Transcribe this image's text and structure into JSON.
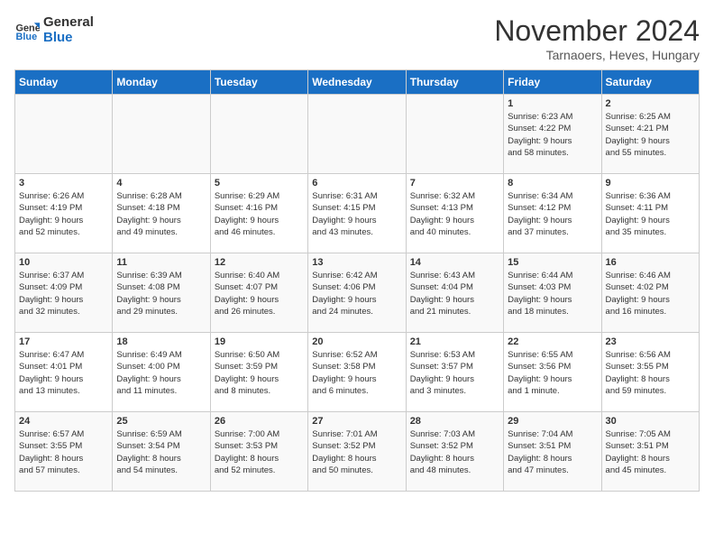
{
  "header": {
    "logo_line1": "General",
    "logo_line2": "Blue",
    "month": "November 2024",
    "location": "Tarnaoers, Heves, Hungary"
  },
  "days_of_week": [
    "Sunday",
    "Monday",
    "Tuesday",
    "Wednesday",
    "Thursday",
    "Friday",
    "Saturday"
  ],
  "weeks": [
    [
      {
        "day": "",
        "info": ""
      },
      {
        "day": "",
        "info": ""
      },
      {
        "day": "",
        "info": ""
      },
      {
        "day": "",
        "info": ""
      },
      {
        "day": "",
        "info": ""
      },
      {
        "day": "1",
        "info": "Sunrise: 6:23 AM\nSunset: 4:22 PM\nDaylight: 9 hours\nand 58 minutes."
      },
      {
        "day": "2",
        "info": "Sunrise: 6:25 AM\nSunset: 4:21 PM\nDaylight: 9 hours\nand 55 minutes."
      }
    ],
    [
      {
        "day": "3",
        "info": "Sunrise: 6:26 AM\nSunset: 4:19 PM\nDaylight: 9 hours\nand 52 minutes."
      },
      {
        "day": "4",
        "info": "Sunrise: 6:28 AM\nSunset: 4:18 PM\nDaylight: 9 hours\nand 49 minutes."
      },
      {
        "day": "5",
        "info": "Sunrise: 6:29 AM\nSunset: 4:16 PM\nDaylight: 9 hours\nand 46 minutes."
      },
      {
        "day": "6",
        "info": "Sunrise: 6:31 AM\nSunset: 4:15 PM\nDaylight: 9 hours\nand 43 minutes."
      },
      {
        "day": "7",
        "info": "Sunrise: 6:32 AM\nSunset: 4:13 PM\nDaylight: 9 hours\nand 40 minutes."
      },
      {
        "day": "8",
        "info": "Sunrise: 6:34 AM\nSunset: 4:12 PM\nDaylight: 9 hours\nand 37 minutes."
      },
      {
        "day": "9",
        "info": "Sunrise: 6:36 AM\nSunset: 4:11 PM\nDaylight: 9 hours\nand 35 minutes."
      }
    ],
    [
      {
        "day": "10",
        "info": "Sunrise: 6:37 AM\nSunset: 4:09 PM\nDaylight: 9 hours\nand 32 minutes."
      },
      {
        "day": "11",
        "info": "Sunrise: 6:39 AM\nSunset: 4:08 PM\nDaylight: 9 hours\nand 29 minutes."
      },
      {
        "day": "12",
        "info": "Sunrise: 6:40 AM\nSunset: 4:07 PM\nDaylight: 9 hours\nand 26 minutes."
      },
      {
        "day": "13",
        "info": "Sunrise: 6:42 AM\nSunset: 4:06 PM\nDaylight: 9 hours\nand 24 minutes."
      },
      {
        "day": "14",
        "info": "Sunrise: 6:43 AM\nSunset: 4:04 PM\nDaylight: 9 hours\nand 21 minutes."
      },
      {
        "day": "15",
        "info": "Sunrise: 6:44 AM\nSunset: 4:03 PM\nDaylight: 9 hours\nand 18 minutes."
      },
      {
        "day": "16",
        "info": "Sunrise: 6:46 AM\nSunset: 4:02 PM\nDaylight: 9 hours\nand 16 minutes."
      }
    ],
    [
      {
        "day": "17",
        "info": "Sunrise: 6:47 AM\nSunset: 4:01 PM\nDaylight: 9 hours\nand 13 minutes."
      },
      {
        "day": "18",
        "info": "Sunrise: 6:49 AM\nSunset: 4:00 PM\nDaylight: 9 hours\nand 11 minutes."
      },
      {
        "day": "19",
        "info": "Sunrise: 6:50 AM\nSunset: 3:59 PM\nDaylight: 9 hours\nand 8 minutes."
      },
      {
        "day": "20",
        "info": "Sunrise: 6:52 AM\nSunset: 3:58 PM\nDaylight: 9 hours\nand 6 minutes."
      },
      {
        "day": "21",
        "info": "Sunrise: 6:53 AM\nSunset: 3:57 PM\nDaylight: 9 hours\nand 3 minutes."
      },
      {
        "day": "22",
        "info": "Sunrise: 6:55 AM\nSunset: 3:56 PM\nDaylight: 9 hours\nand 1 minute."
      },
      {
        "day": "23",
        "info": "Sunrise: 6:56 AM\nSunset: 3:55 PM\nDaylight: 8 hours\nand 59 minutes."
      }
    ],
    [
      {
        "day": "24",
        "info": "Sunrise: 6:57 AM\nSunset: 3:55 PM\nDaylight: 8 hours\nand 57 minutes."
      },
      {
        "day": "25",
        "info": "Sunrise: 6:59 AM\nSunset: 3:54 PM\nDaylight: 8 hours\nand 54 minutes."
      },
      {
        "day": "26",
        "info": "Sunrise: 7:00 AM\nSunset: 3:53 PM\nDaylight: 8 hours\nand 52 minutes."
      },
      {
        "day": "27",
        "info": "Sunrise: 7:01 AM\nSunset: 3:52 PM\nDaylight: 8 hours\nand 50 minutes."
      },
      {
        "day": "28",
        "info": "Sunrise: 7:03 AM\nSunset: 3:52 PM\nDaylight: 8 hours\nand 48 minutes."
      },
      {
        "day": "29",
        "info": "Sunrise: 7:04 AM\nSunset: 3:51 PM\nDaylight: 8 hours\nand 47 minutes."
      },
      {
        "day": "30",
        "info": "Sunrise: 7:05 AM\nSunset: 3:51 PM\nDaylight: 8 hours\nand 45 minutes."
      }
    ]
  ]
}
